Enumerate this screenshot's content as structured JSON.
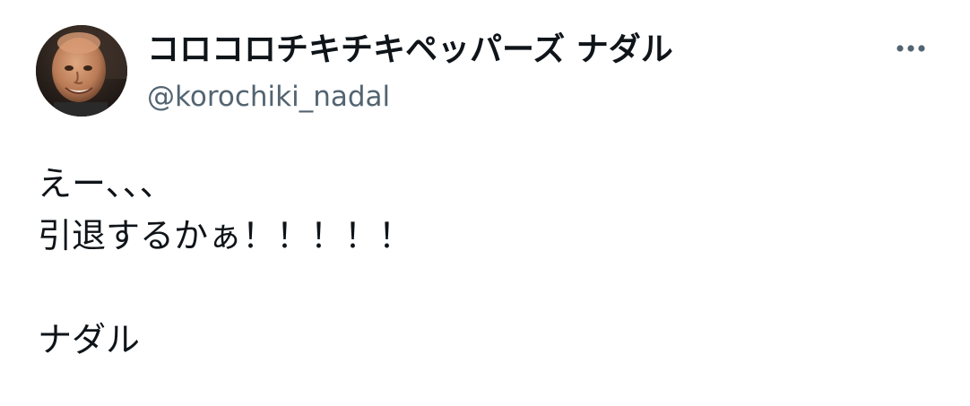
{
  "author": {
    "display_name": "コロコロチキチキペッパーズ ナダル",
    "handle": "@korochiki_nadal",
    "avatar_icon": "profile-photo"
  },
  "menu": {
    "more_icon": "more-horizontal-icon"
  },
  "tweet": {
    "lines": [
      "えー、、、",
      "引退するかぁ！！！！！",
      "",
      "ナダル"
    ]
  },
  "colors": {
    "text_primary": "#0f1419",
    "text_secondary": "#536471",
    "background": "#ffffff"
  }
}
